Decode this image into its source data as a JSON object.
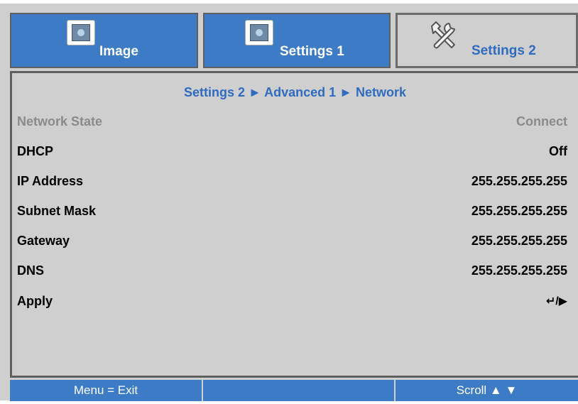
{
  "tabs": [
    {
      "label": "Image",
      "icon": "image-icon",
      "active": false
    },
    {
      "label": "Settings 1",
      "icon": "settings-icon",
      "active": false
    },
    {
      "label": "Settings 2",
      "icon": "tools-icon",
      "active": true
    }
  ],
  "breadcrumb": "Settings 2 ► Advanced 1 ► Network",
  "rows": [
    {
      "label": "Network State",
      "value": "Connect",
      "disabled": true
    },
    {
      "label": "DHCP",
      "value": "Off"
    },
    {
      "label": "IP Address",
      "value": "255.255.255.255"
    },
    {
      "label": "Subnet Mask",
      "value": "255.255.255.255"
    },
    {
      "label": "Gateway",
      "value": "255.255.255.255"
    },
    {
      "label": "DNS",
      "value": "255.255.255.255"
    },
    {
      "label": "Apply",
      "value": "↵/▶"
    }
  ],
  "footer": {
    "left": "Menu = Exit",
    "middle": "",
    "right": "Scroll ▲ ▼"
  },
  "colors": {
    "tab_blue": "#3d7bc4",
    "panel_gray": "#cfcfcf",
    "accent_text": "#2f6bbf"
  }
}
